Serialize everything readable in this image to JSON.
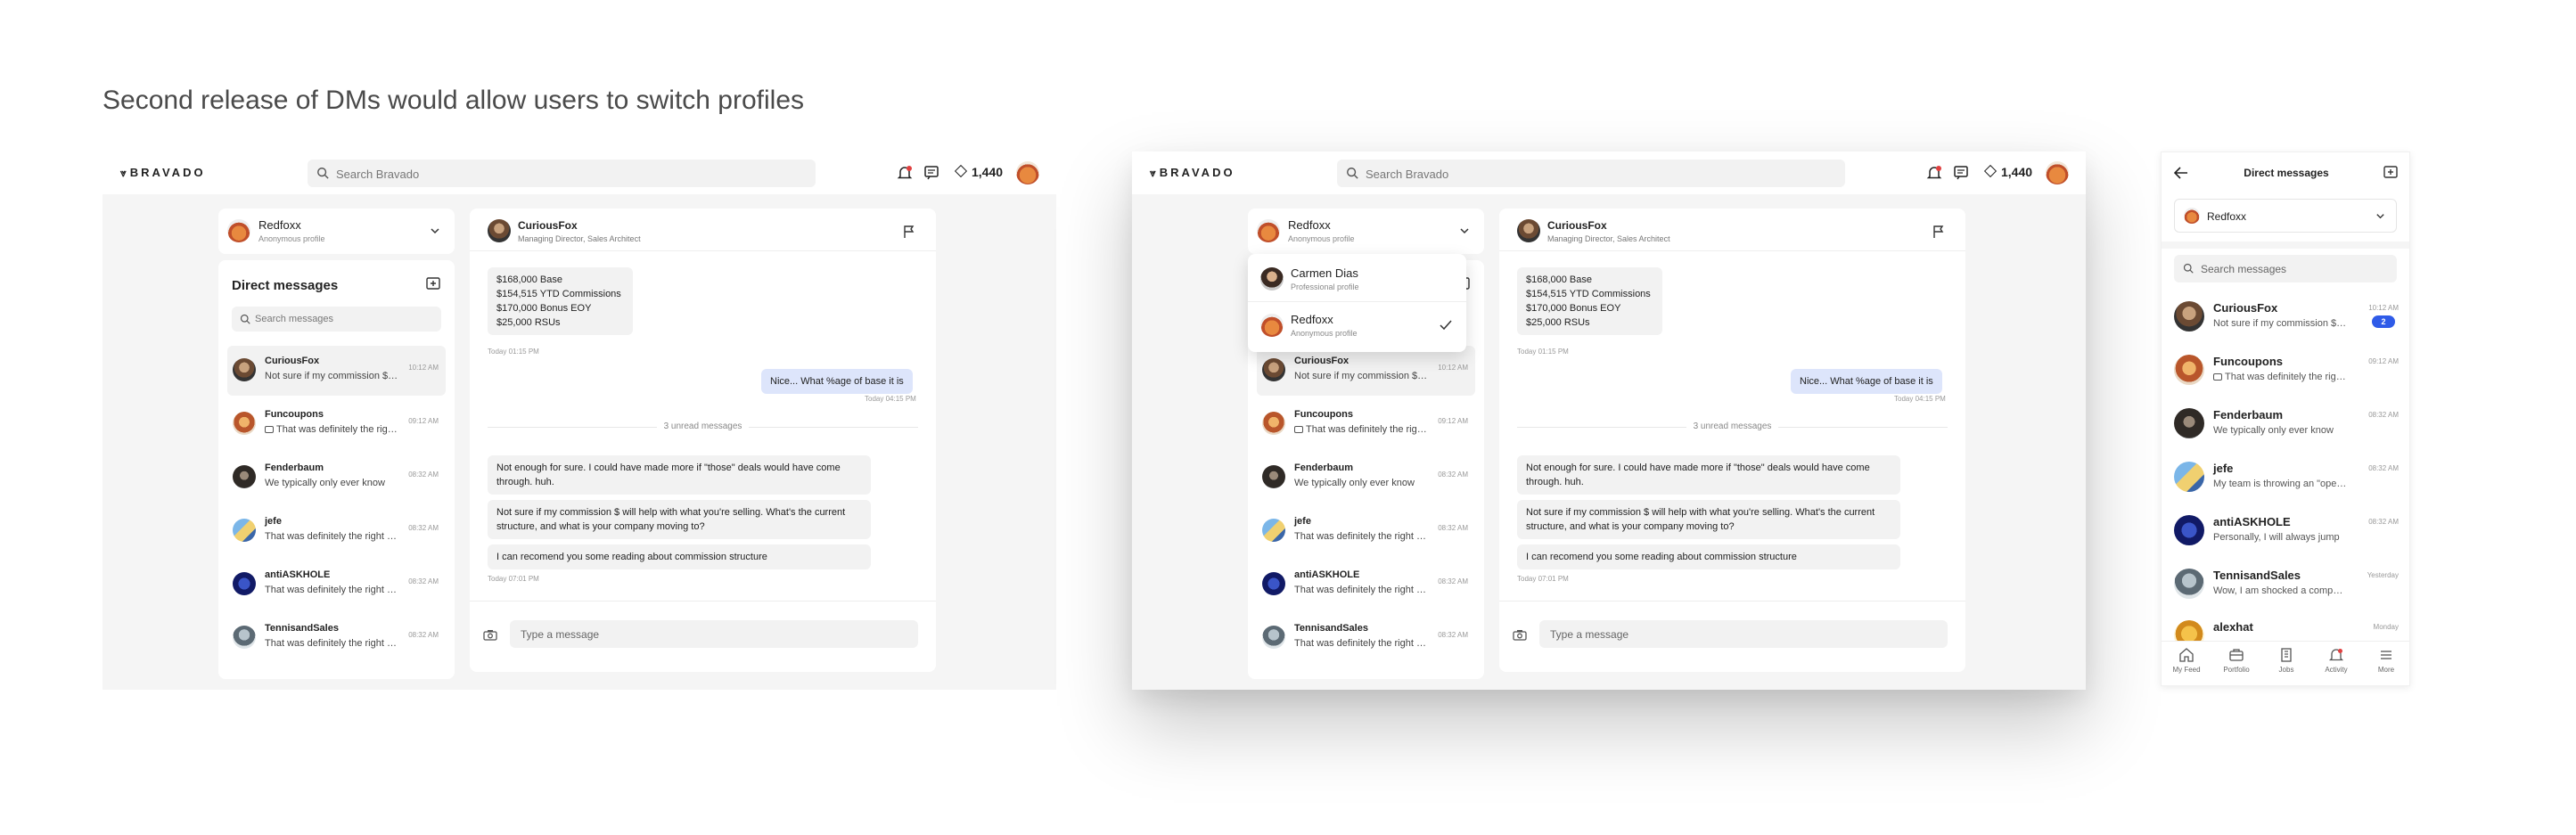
{
  "headline": "Second release of DMs would allow users to switch profiles",
  "topbar": {
    "logo": "BRAVADO",
    "logo_mark": "⩔",
    "search_placeholder": "Search Bravado",
    "points": "1,440"
  },
  "profile": {
    "name": "Redfoxx",
    "sub": "Anonymous profile"
  },
  "dropdown": {
    "items": [
      {
        "name": "Carmen Dias",
        "sub": "Professional profile"
      },
      {
        "name": "Redfoxx",
        "sub": "Anonymous profile"
      }
    ]
  },
  "dm": {
    "title": "Direct messages",
    "search_placeholder": "Search messages",
    "conversations": [
      {
        "name": "CuriousFox",
        "preview": "Not sure if my commission $ will help",
        "time": "10:12 AM"
      },
      {
        "name": "Funcoupons",
        "preview": "That was definitely the right call",
        "time": "09:12 AM"
      },
      {
        "name": "Fenderbaum",
        "preview": "We typically only ever know",
        "time": "08:32 AM"
      },
      {
        "name": "jefe",
        "preview": "That was definitely the right call",
        "time": "08:32 AM"
      },
      {
        "name": "antiASKHOLE",
        "preview": "That was definitely the right call",
        "time": "08:32 AM"
      },
      {
        "name": "TennisandSales",
        "preview": "That was definitely the right call",
        "time": "08:32 AM"
      }
    ]
  },
  "chat": {
    "name": "CuriousFox",
    "sub": "Managing Director, Sales Architect",
    "comp_lines": [
      "$168,000 Base",
      "$154,515 YTD Commissions",
      "$170,000 Bonus EOY",
      "$25,000 RSUs"
    ],
    "stamp1": "Today 01:15 PM",
    "mine": "Nice... What %age of base it is",
    "stamp2": "Today 04:15 PM",
    "unread": "3 unread messages",
    "msg1": "Not enough for sure. I could have made more if \"those\" deals would have come through. huh.",
    "msg2": "Not sure if my commission $ will help with what you're selling. What's the current structure, and what is your company moving to?",
    "msg3": "I can recomend you some reading about commission structure",
    "stamp3": "Today 07:01 PM",
    "input_placeholder": "Type a message"
  },
  "mobile": {
    "title": "Direct messages",
    "profile_name": "Redfoxx",
    "search_placeholder": "Search messages",
    "conversations": [
      {
        "name": "CuriousFox",
        "preview": "Not sure if my commission $ will help",
        "time": "10:12 AM",
        "badge": "2"
      },
      {
        "name": "Funcoupons",
        "preview": "That was definitely the right call",
        "time": "09:12 AM"
      },
      {
        "name": "Fenderbaum",
        "preview": "We typically only ever know",
        "time": "08:32 AM"
      },
      {
        "name": "jefe",
        "preview": "My team is throwing an \"open house\"",
        "time": "08:32 AM"
      },
      {
        "name": "antiASKHOLE",
        "preview": "Personally, I will always jump",
        "time": "08:32 AM"
      },
      {
        "name": "TennisandSales",
        "preview": "Wow, I am shocked a company",
        "time": "Yesterday"
      },
      {
        "name": "alexhat",
        "preview": "",
        "time": "Monday"
      }
    ],
    "nav": [
      "My Feed",
      "Portfolio",
      "Jobs",
      "Activity",
      "More"
    ]
  },
  "colors": {
    "accent": "#2f5be8",
    "mine_bubble": "#dde5fb",
    "frame_bg": "#f5f5f5"
  }
}
